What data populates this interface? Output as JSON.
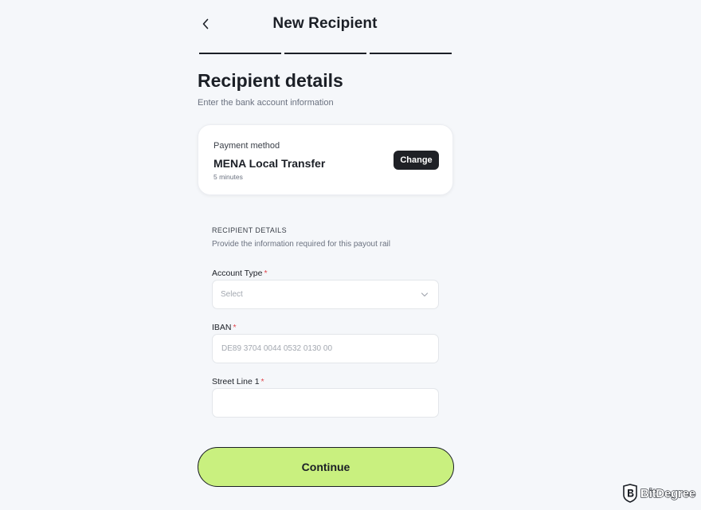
{
  "header": {
    "title": "New Recipient",
    "back_icon": "chevron-left-icon",
    "steps_total": 3,
    "steps_completed": 3
  },
  "section": {
    "title": "Recipient details",
    "subtitle": "Enter the bank account information"
  },
  "payment_card": {
    "label": "Payment method",
    "method": "MENA Local Transfer",
    "eta": "5 minutes",
    "change_label": "Change"
  },
  "details": {
    "heading": "RECIPIENT DETAILS",
    "subtitle": "Provide the information required for this payout rail",
    "fields": [
      {
        "label": "Account Type",
        "required_mark": "*",
        "placeholder": "Select",
        "value": ""
      },
      {
        "label": "IBAN",
        "required_mark": "*",
        "placeholder": "DE89 3704 0044 0532 0130 00",
        "value": ""
      },
      {
        "label": "Street Line 1",
        "required_mark": "*",
        "placeholder": "",
        "value": ""
      }
    ]
  },
  "continue_label": "Continue",
  "watermark": {
    "text": "BitDegree",
    "icon": "bitdegree-shield-logo-icon"
  },
  "colors": {
    "background": "#f5f7fa",
    "accent": "#c9f07f",
    "dark": "#1b1f26",
    "required": "#e0454b"
  }
}
